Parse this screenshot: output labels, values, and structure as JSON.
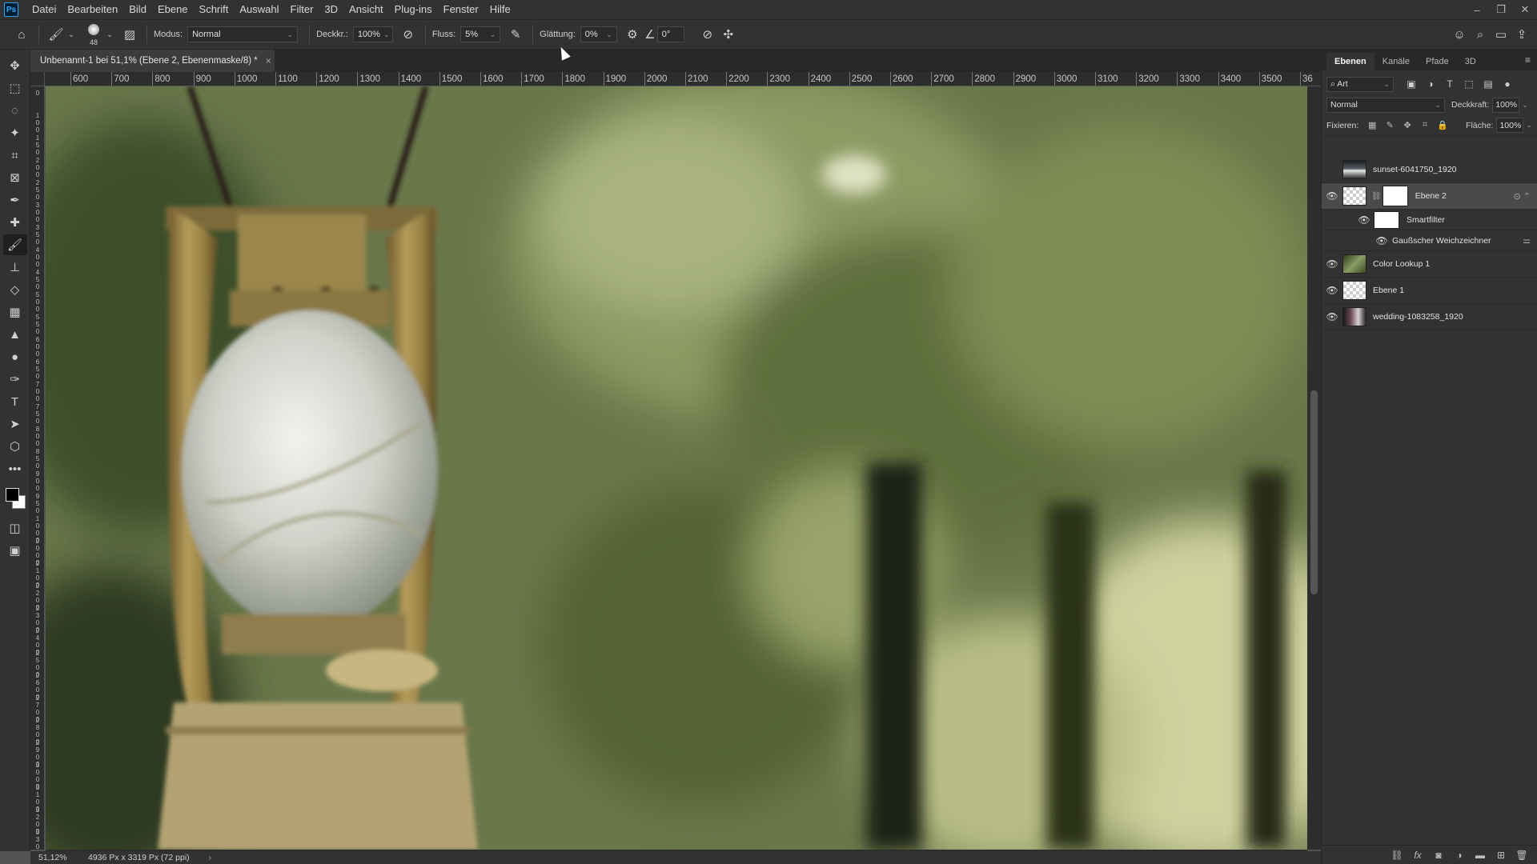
{
  "app": {
    "logo": "Ps"
  },
  "menu": [
    "Datei",
    "Bearbeiten",
    "Bild",
    "Ebene",
    "Schrift",
    "Auswahl",
    "Filter",
    "3D",
    "Ansicht",
    "Plug-ins",
    "Fenster",
    "Hilfe"
  ],
  "window_controls": [
    "–",
    "❐",
    "✕"
  ],
  "options": {
    "brush_size": "48",
    "mode_label": "Modus:",
    "mode_value": "Normal",
    "opacity_label": "Deckkr.:",
    "opacity_value": "100%",
    "flow_label": "Fluss:",
    "flow_value": "5%",
    "smoothing_label": "Glättung:",
    "smoothing_value": "0%",
    "angle_value": "0°"
  },
  "document": {
    "tab_title": "Unbenannt-1 bei 51,1% (Ebene 2, Ebenenmaske/8) *",
    "zoom": "51,12%",
    "info": "4936 Px x 3319 Px (72 ppi)"
  },
  "ruler_h": [
    "600",
    "700",
    "800",
    "900",
    "1000",
    "1100",
    "1200",
    "1300",
    "1400",
    "1500",
    "1600",
    "1700",
    "1800",
    "1900",
    "2000",
    "2100",
    "2200",
    "2300",
    "2400",
    "2500",
    "2600",
    "2700",
    "2800",
    "2900",
    "3000",
    "3100",
    "3200",
    "3300",
    "3400",
    "3500",
    "36"
  ],
  "ruler_v": [
    "0",
    "1 0 0",
    "1 5 0",
    "2 0 0",
    "2 5 0",
    "3 0 0",
    "3 5 0",
    "4 0 0",
    "4 5 0",
    "5 0 0",
    "5 5 0",
    "6 0 0",
    "6 5 0",
    "7 0 0",
    "7 5 0",
    "8 0 0",
    "8 5 0",
    "9 0 0",
    "9 5 0",
    "1 0 0 0",
    "2 0 0 0",
    "2 1 0 0",
    "2 2 0 0",
    "2 3 0 0",
    "2 4 0 0",
    "2 5 0 0",
    "2 6 0 0",
    "2 7 0 0",
    "2 8 0 0",
    "2 9 0 0",
    "3 0 0 0",
    "3 1 0 0",
    "3 2 0 0",
    "3 3 0 0"
  ],
  "panel": {
    "tabs": [
      "Ebenen",
      "Kanäle",
      "Pfade",
      "3D"
    ],
    "filter_kind": "Art",
    "blend_mode": "Normal",
    "opacity_label": "Deckkraft:",
    "opacity_value": "100%",
    "lock_label": "Fixieren:",
    "fill_label": "Fläche:",
    "fill_value": "100%",
    "layers": [
      {
        "name": "sunset-6041750_1920",
        "visible": false
      },
      {
        "name": "Ebene 2",
        "visible": true,
        "selected": true
      },
      {
        "name": "Smartfilter"
      },
      {
        "name": "Gaußscher Weichzeichner"
      },
      {
        "name": "Color Lookup 1",
        "visible": true
      },
      {
        "name": "Ebene 1",
        "visible": true
      },
      {
        "name": "wedding-1083258_1920",
        "visible": true
      }
    ]
  },
  "colors": {
    "foreground": "#000000",
    "background": "#ffffff",
    "accent": "#31a8ff"
  }
}
